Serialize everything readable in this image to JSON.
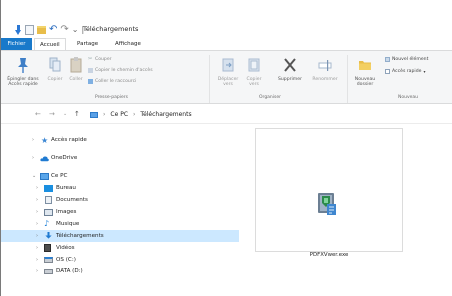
{
  "window": {
    "title": "Téléchargements"
  },
  "quick_access_toolbar": {
    "separator": "|",
    "customize": "⌄"
  },
  "tabs": {
    "file": "Fichier",
    "home": "Accueil",
    "share": "Partage",
    "view": "Affichage"
  },
  "ribbon": {
    "clipboard": {
      "pin": "Épingler dans Accès rapide",
      "copy": "Copier",
      "paste": "Coller",
      "cut": "Couper",
      "copy_path": "Copier le chemin d'accès",
      "paste_shortcut": "Coller le raccourci",
      "group_label": "Presse-papiers"
    },
    "organize": {
      "move_to": "Déplacer vers",
      "copy_to": "Copier vers",
      "delete": "Supprimer",
      "rename": "Renommer",
      "group_label": "Organiser"
    },
    "new": {
      "new_folder": "Nouveau dossier",
      "new_item": "Nouvel élément",
      "quick_access": "Accès rapide",
      "group_label": "Nouveau"
    }
  },
  "address_bar": {
    "back": "←",
    "forward": "→",
    "recent": "⌄",
    "up": "↑",
    "breadcrumbs": [
      "Ce PC",
      "Téléchargements"
    ],
    "separator": "›"
  },
  "nav_pane": {
    "items": [
      {
        "label": "Accès rapide",
        "icon": "star-icon",
        "expander": "›"
      },
      {
        "label": "OneDrive",
        "icon": "cloud-icon",
        "expander": "›"
      },
      {
        "label": "Ce PC",
        "icon": "computer-icon",
        "expander": "⌄"
      },
      {
        "label": "Bureau",
        "icon": "desktop-icon",
        "expander": "›"
      },
      {
        "label": "Documents",
        "icon": "documents-icon",
        "expander": "›"
      },
      {
        "label": "Images",
        "icon": "pictures-icon",
        "expander": "›"
      },
      {
        "label": "Musique",
        "icon": "music-icon",
        "expander": "›"
      },
      {
        "label": "Téléchargements",
        "icon": "downloads-icon",
        "expander": "›",
        "selected": true
      },
      {
        "label": "Vidéos",
        "icon": "videos-icon",
        "expander": "›"
      },
      {
        "label": "OS (C:)",
        "icon": "drive-icon",
        "expander": "›"
      },
      {
        "label": "DATA (D:)",
        "icon": "drive-icon",
        "expander": "›"
      }
    ]
  },
  "files": [
    {
      "name": "PDFXVwer.exe",
      "icon": "installer-icon"
    }
  ],
  "colors": {
    "accent": "#1979ca",
    "selection": "#cce8ff",
    "folder": "#e8bd4a"
  }
}
